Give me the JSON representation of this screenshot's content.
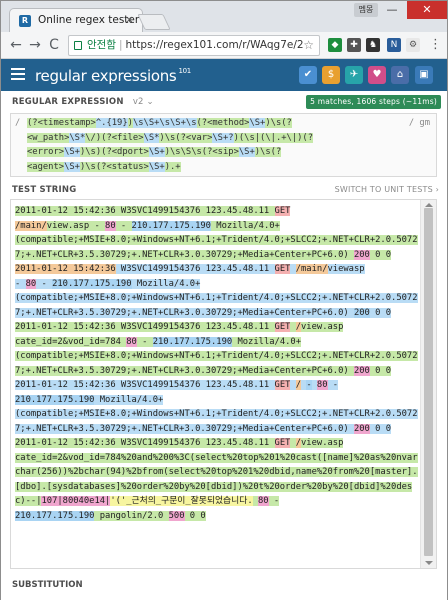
{
  "browser": {
    "tab_title": "Online regex tester and",
    "tab_favicon": "R",
    "tab_close": "×",
    "user_label": "멤몽",
    "window_min": "—",
    "window_max": "❐",
    "window_close": "✕",
    "back": "←",
    "forward": "→",
    "reload": "C",
    "secure_label": "안전함",
    "url": "https://regex101.com/r/WAqg7e/2",
    "star": "☆",
    "menu": "⋮"
  },
  "header": {
    "logo_main": "regular",
    "logo_expr": "expressions",
    "logo_sup": "101",
    "icons": [
      "save-icon",
      "donate-icon",
      "telegram-icon",
      "bug-icon",
      "library-icon",
      "account-icon"
    ],
    "icon_glyphs": [
      "✔",
      "$",
      "✈",
      "♥",
      "⌂",
      "▣"
    ],
    "icon_colors": [
      "#4a8fd1",
      "#e8a030",
      "#27a4a9",
      "#d14e8a",
      "#4a6da8",
      "#3a7ab8"
    ]
  },
  "regex_section": {
    "title": "REGULAR EXPRESSION",
    "version": "v2 ⌄",
    "matches": "5 matches, 1606 steps (~11ms)",
    "delimiter": "/",
    "flags": "/ gm",
    "regex_lines": [
      [
        {
          "t": "(?<timestamp>",
          "c": "rg"
        },
        {
          "t": "^.{19}",
          "c": "rb"
        },
        {
          "t": ")",
          "c": "rg"
        },
        {
          "t": "\\s\\S+\\s\\S+\\s",
          "c": "rb"
        },
        {
          "t": "(?<method>",
          "c": "rg"
        },
        {
          "t": "\\S+",
          "c": "rb"
        },
        {
          "t": ")\\s",
          "c": "rg"
        },
        {
          "t": "(?",
          "c": "rg"
        }
      ],
      [
        {
          "t": "<w_path>",
          "c": "rg"
        },
        {
          "t": "\\S*",
          "c": "rb"
        },
        {
          "t": "\\/)",
          "c": "rg"
        },
        {
          "t": "(?<file>",
          "c": "rg"
        },
        {
          "t": "\\S*",
          "c": "rb"
        },
        {
          "t": ")\\s(?<var>",
          "c": "rg"
        },
        {
          "t": "\\S+?",
          "c": "rb"
        },
        {
          "t": ")(\\s|(\\|.+\\|)(?",
          "c": "rg"
        }
      ],
      [
        {
          "t": "<error>",
          "c": "rg"
        },
        {
          "t": "\\S+",
          "c": "rb"
        },
        {
          "t": ")\\s)(?<dport>",
          "c": "rg"
        },
        {
          "t": "\\S+",
          "c": "rb"
        },
        {
          "t": ")\\s\\S\\s(?<sip>",
          "c": "rg"
        },
        {
          "t": "\\S+",
          "c": "rb"
        },
        {
          "t": ")\\s(?",
          "c": "rg"
        }
      ],
      [
        {
          "t": "<agent>",
          "c": "rg"
        },
        {
          "t": "\\S+",
          "c": "rb"
        },
        {
          "t": ")\\s(?<status>",
          "c": "rg"
        },
        {
          "t": "\\S+",
          "c": "rb"
        },
        {
          "t": ").+",
          "c": "rg"
        }
      ]
    ]
  },
  "test_section": {
    "title": "TEST STRING",
    "switch_label": "SWITCH TO UNIT TESTS ›",
    "segments": [
      {
        "t": "2011-01-12 15:42:36",
        "c": "g1"
      },
      {
        "t": " W3SVC1499154376 123.45.48.11 ",
        "c": "g1"
      },
      {
        "t": "GET",
        "c": "gr"
      },
      {
        "t": "\n",
        "c": ""
      },
      {
        "t": "/main/",
        "c": "go"
      },
      {
        "t": "view.asp",
        "c": "g1"
      },
      {
        "t": " - ",
        "c": "g1"
      },
      {
        "t": "80",
        "c": "gpk"
      },
      {
        "t": " - ",
        "c": "g1"
      },
      {
        "t": "210.177.175.190",
        "c": "gb"
      },
      {
        "t": " Mozilla/4.0+",
        "c": "g1"
      },
      {
        "t": "\n",
        "c": ""
      },
      {
        "t": "(compatible;+MSIE+8.0;+Windows+NT+6.1;+Trident/4.0;+SLCC2;+.NET+CLR+2.0.50727;+.NET+CLR+3.5.30729;+.NET+CLR+3.0.30729;+Media+Center+PC+6.0)",
        "c": "g1"
      },
      {
        "t": " ",
        "c": "g1"
      },
      {
        "t": "200",
        "c": "gpk"
      },
      {
        "t": " 0 0",
        "c": "g1"
      },
      {
        "t": "\n",
        "c": ""
      },
      {
        "t": "2011-01-12 15:42:36",
        "c": "go"
      },
      {
        "t": " W3SVC1499154376 123.45.48.11 ",
        "c": "m2"
      },
      {
        "t": "GET",
        "c": "gr"
      },
      {
        "t": " ",
        "c": "m2"
      },
      {
        "t": "/main/",
        "c": "go"
      },
      {
        "t": "viewasp",
        "c": "m2"
      },
      {
        "t": "\n",
        "c": ""
      },
      {
        "t": " - ",
        "c": "m2"
      },
      {
        "t": "80",
        "c": "gpk"
      },
      {
        "t": " - ",
        "c": "m2"
      },
      {
        "t": "210.177.175.190",
        "c": "gb"
      },
      {
        "t": " Mozilla/4.0+",
        "c": "m2"
      },
      {
        "t": "\n",
        "c": ""
      },
      {
        "t": "(compatible;+MSIE+8.0;+Windows+NT+6.1;+Trident/4.0;+SLCC2;+.NET+CLR+2.0.50727;+.NET+CLR+3.5.30729;+.NET+CLR+3.0.30729;+Media+Center+PC+6.0)",
        "c": "m2"
      },
      {
        "t": " ",
        "c": "m2"
      },
      {
        "t": "200",
        "c": "gb"
      },
      {
        "t": " 0 0",
        "c": "m2"
      },
      {
        "t": "\n",
        "c": ""
      },
      {
        "t": "2011-01-12 15:42:36",
        "c": "g1"
      },
      {
        "t": " W3SVC1499154376 123.45.48.11 ",
        "c": "g1"
      },
      {
        "t": "GET",
        "c": "gr"
      },
      {
        "t": " ",
        "c": "g1"
      },
      {
        "t": "/",
        "c": "go"
      },
      {
        "t": "view.asp",
        "c": "g1"
      },
      {
        "t": "\n",
        "c": ""
      },
      {
        "t": "cate_id=2&vod_id=784",
        "c": "g1"
      },
      {
        "t": " ",
        "c": "g1"
      },
      {
        "t": "80",
        "c": "gpk"
      },
      {
        "t": " - ",
        "c": "g1"
      },
      {
        "t": "210.177.175.190",
        "c": "gb"
      },
      {
        "t": " Mozilla/4.0+",
        "c": "g1"
      },
      {
        "t": "\n",
        "c": ""
      },
      {
        "t": "(compatible;+MSIE+8.0;+Windows+NT+6.1;+Trident/4.0;+SLCC2;+.NET+CLR+2.0.50727;+.NET+CLR+3.5.30729;+.NET+CLR+3.0.30729;+Media+Center+PC+6.0)",
        "c": "g1"
      },
      {
        "t": " ",
        "c": "g1"
      },
      {
        "t": "200",
        "c": "gpk"
      },
      {
        "t": " 0 0",
        "c": "g1"
      },
      {
        "t": "\n",
        "c": ""
      },
      {
        "t": "2011-01-12 15:42:36",
        "c": "m2"
      },
      {
        "t": " W3SVC1499154376 123.45.48.11 ",
        "c": "m2"
      },
      {
        "t": "GET",
        "c": "gr"
      },
      {
        "t": " ",
        "c": "m2"
      },
      {
        "t": "/",
        "c": "go"
      },
      {
        "t": " ",
        "c": "m2"
      },
      {
        "t": "-",
        "c": "gb"
      },
      {
        "t": " ",
        "c": "m2"
      },
      {
        "t": "80",
        "c": "gpk"
      },
      {
        "t": " -",
        "c": "m2"
      },
      {
        "t": "\n",
        "c": ""
      },
      {
        "t": "210.177.175.190",
        "c": "gb"
      },
      {
        "t": " Mozilla/4.0+",
        "c": "m2"
      },
      {
        "t": "\n",
        "c": ""
      },
      {
        "t": "(compatible;+MSIE+8.0;+Windows+NT+6.1;+Trident/4.0;+SLCC2;+.NET+CLR+2.0.50727;+.NET+CLR+3.5.30729;+.NET+CLR+3.0.30729;+Media+Center+PC+6.0)",
        "c": "m2"
      },
      {
        "t": " ",
        "c": "m2"
      },
      {
        "t": "200",
        "c": "gpk"
      },
      {
        "t": " 0 0",
        "c": "m2"
      },
      {
        "t": "\n",
        "c": ""
      },
      {
        "t": "2011-01-12 15:42:36",
        "c": "g1"
      },
      {
        "t": " W3SVC1499154376 123.45.48.11 ",
        "c": "g1"
      },
      {
        "t": "GET",
        "c": "gr"
      },
      {
        "t": " ",
        "c": "g1"
      },
      {
        "t": "/",
        "c": "go"
      },
      {
        "t": "view.asp",
        "c": "g1"
      },
      {
        "t": "\n",
        "c": ""
      },
      {
        "t": "cate_id=2&vod_id=784%20and%200%3C(select%20top%201%20cast([name]%20as%20nvarchar(256))%2bchar(94)%2bfrom(select%20top%201%20dbid,name%20from%20[master].[dbo].[sysdatabases]%20order%20by%20[dbid])%20t%20order%20by%20[dbid]%20desc)--",
        "c": "g1"
      },
      {
        "t": "|",
        "c": "g1"
      },
      {
        "t": "107|80040e14|",
        "c": "gpk"
      },
      {
        "t": "'('_근처의_구문이_잘못되었습니다.",
        "c": "gy"
      },
      {
        "t": " ",
        "c": "g1"
      },
      {
        "t": "80",
        "c": "gpk"
      },
      {
        "t": " -",
        "c": "g1"
      },
      {
        "t": "\n",
        "c": ""
      },
      {
        "t": "210.177.175.190",
        "c": "gb"
      },
      {
        "t": " pangolin/2.0 ",
        "c": "g1"
      },
      {
        "t": "500",
        "c": "gpk"
      },
      {
        "t": " 0 0",
        "c": "g1"
      }
    ]
  },
  "substitution": {
    "title": "SUBSTITUTION"
  }
}
